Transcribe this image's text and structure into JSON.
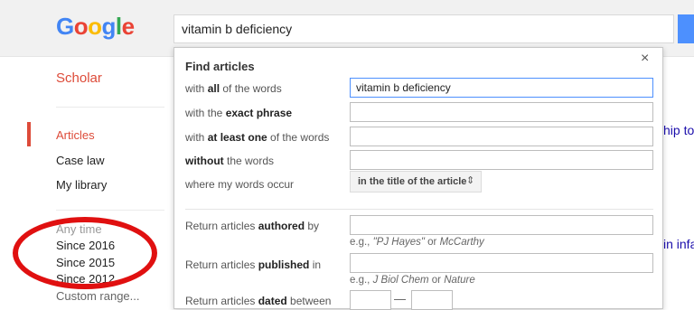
{
  "header": {
    "logo": "Google",
    "search_value": "vitamin b deficiency"
  },
  "sidebar": {
    "brand": "Scholar",
    "items": [
      {
        "label": "Articles"
      },
      {
        "label": "Case law"
      },
      {
        "label": "My library"
      }
    ],
    "time": {
      "any_time": "Any time",
      "options": [
        "Since 2016",
        "Since 2015",
        "Since 2012"
      ],
      "custom": "Custom range..."
    }
  },
  "results_peek": [
    "hip to",
    "in infa"
  ],
  "advanced_search": {
    "title": "Find articles",
    "close_label": "×",
    "all_words": {
      "pre": "with ",
      "bold": "all",
      "post": " of the words",
      "value": "vitamin b deficiency"
    },
    "exact_phrase": {
      "pre": "with the ",
      "bold": "exact phrase",
      "post": "",
      "value": ""
    },
    "at_least_one": {
      "pre": "with ",
      "bold": "at least one",
      "post": " of the words",
      "value": ""
    },
    "without": {
      "pre": "",
      "bold": "without",
      "post": " the words",
      "value": ""
    },
    "occur": {
      "label": "where my words occur",
      "selected": "in the title of the article",
      "arrow": "⇕"
    },
    "authored": {
      "pre": "Return articles ",
      "bold": "authored",
      "post": " by",
      "hint_pre": "e.g., ",
      "hint_ex1": "\"PJ Hayes\"",
      "hint_mid": " or ",
      "hint_ex2": "McCarthy"
    },
    "published": {
      "pre": "Return articles ",
      "bold": "published",
      "post": " in",
      "hint_pre": "e.g., ",
      "hint_ex1": "J Biol Chem",
      "hint_mid": " or ",
      "hint_ex2": "Nature"
    },
    "dated": {
      "pre": "Return articles ",
      "bold": "dated",
      "post": " between",
      "dash": "—"
    }
  },
  "colors": {
    "brand_red": "#dd4b39",
    "accent_blue": "#4d90fe",
    "annotation_red": "#e01010"
  }
}
